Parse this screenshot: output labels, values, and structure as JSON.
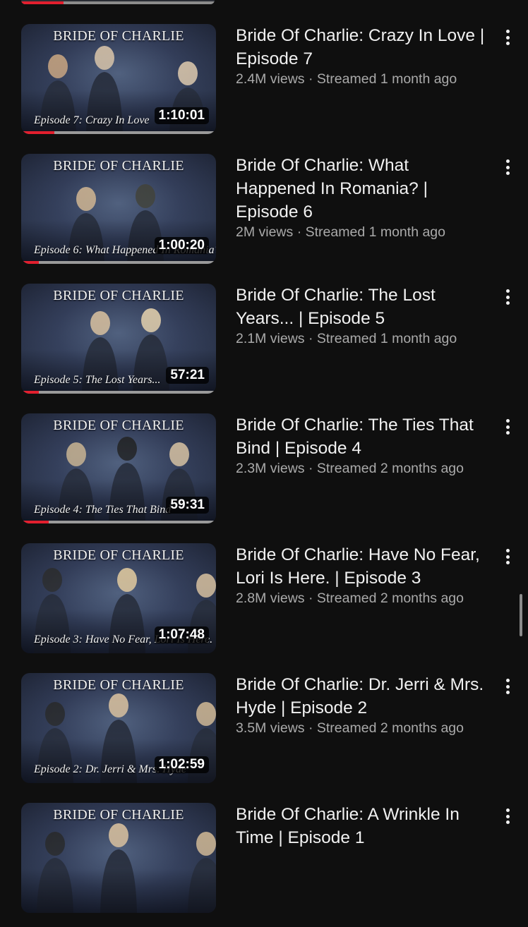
{
  "videos": [
    {
      "title": "Bride Of Charlie: Crazy In Love | Episode 7",
      "views": "2.4M views",
      "separator": "·",
      "streamed": "Streamed 1 month ago",
      "duration": "1:10:01",
      "thumb_brand": "BRIDE OF CHARLIE",
      "thumb_subtitle": "Episode 7: Crazy In Love",
      "progress": 0.17
    },
    {
      "title": "Bride Of Charlie: What Happened In Romania? | Episode 6",
      "views": "2M views",
      "separator": "·",
      "streamed": "Streamed 1 month ago",
      "duration": "1:00:20",
      "thumb_brand": "BRIDE OF CHARLIE",
      "thumb_subtitle": "Episode 6: What Happened In Romania?",
      "progress": 0.09
    },
    {
      "title": "Bride Of Charlie: The Lost Years... | Episode 5",
      "views": "2.1M views",
      "separator": "·",
      "streamed": "Streamed 1 month ago",
      "duration": "57:21",
      "thumb_brand": "BRIDE OF CHARLIE",
      "thumb_subtitle": "Episode 5: The Lost Years...",
      "progress": 0.09
    },
    {
      "title": "Bride Of Charlie: The Ties That Bind | Episode 4",
      "views": "2.3M views",
      "separator": "·",
      "streamed": "Streamed 2 months ago",
      "duration": "59:31",
      "thumb_brand": "BRIDE OF CHARLIE",
      "thumb_subtitle": "Episode 4: The Ties That Bind",
      "progress": 0.14
    },
    {
      "title": "Bride Of Charlie: Have No Fear, Lori Is Here. | Episode 3",
      "views": "2.8M views",
      "separator": "·",
      "streamed": "Streamed 2 months ago",
      "duration": "1:07:48",
      "thumb_brand": "BRIDE OF CHARLIE",
      "thumb_subtitle": "Episode 3: Have No Fear, Lori Is Here.",
      "progress": 0
    },
    {
      "title": "Bride Of Charlie: Dr. Jerri & Mrs. Hyde | Episode 2",
      "views": "3.5M views",
      "separator": "·",
      "streamed": "Streamed 2 months ago",
      "duration": "1:02:59",
      "thumb_brand": "BRIDE OF CHARLIE",
      "thumb_subtitle": "Episode 2: Dr. Jerri & Mrs. Hyde",
      "progress": 0
    },
    {
      "title": "Bride Of Charlie: A Wrinkle In Time | Episode 1",
      "views": "",
      "separator": "",
      "streamed": "",
      "duration": "",
      "thumb_brand": "BRIDE OF CHARLIE",
      "thumb_subtitle": "",
      "progress": 0
    }
  ],
  "colors": {
    "background": "#0f0f0f",
    "progress_red": "#e21f2e",
    "meta_gray": "#aaaaaa"
  },
  "icons": {
    "menu": "three-dots-vertical-icon"
  }
}
